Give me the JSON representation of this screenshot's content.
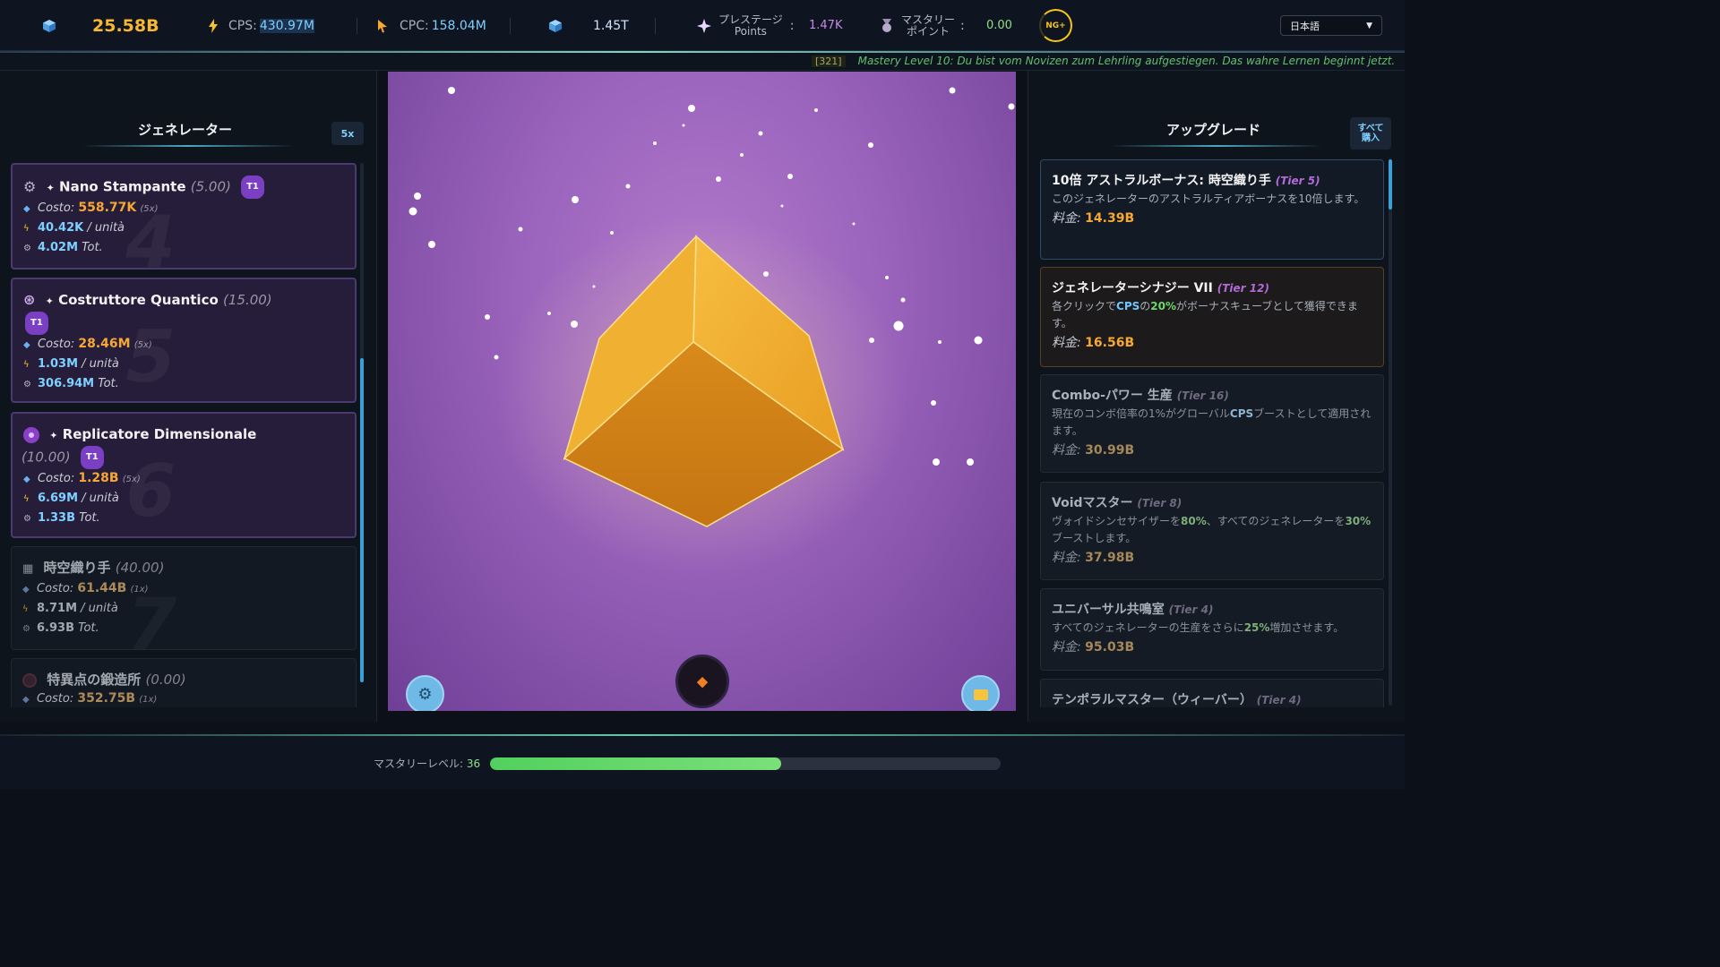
{
  "topbar": {
    "cubes": "25.58B",
    "cps_label": "CPS:",
    "cps_value": "430.97M",
    "cpc_label": "CPC:",
    "cpc_value": "158.04M",
    "total": "1.45T",
    "prestige_label_1": "プレステージ",
    "prestige_label_2": "Points",
    "prestige_colon": ":",
    "prestige_value": "1.47K",
    "mastery_label_1": "マスタリー",
    "mastery_label_2": "ポイント",
    "mastery_colon": ":",
    "mastery_value": "0.00",
    "ng_badge": "NG+",
    "language": "日本語"
  },
  "ticker": {
    "code": "[321]",
    "message": "Mastery Level 10: Du bist vom Novizen zum Lehrling aufgestiegen. Das wahre Lernen beginnt jetzt."
  },
  "generators": {
    "title": "ジェネレーター",
    "multiplier": "5x",
    "items": [
      {
        "name": "Nano Stampante",
        "owned": "(5.00)",
        "tier": "T1",
        "cost_label": "Costo:",
        "cost": "558.77K",
        "mult": "(5x)",
        "rate": "40.42K",
        "rate_unit": "/ unità",
        "total": "4.02M",
        "total_unit": "Tot.",
        "bg_number": "4"
      },
      {
        "name": "Costruttore Quantico",
        "owned": "(15.00)",
        "tier": "T1",
        "cost_label": "Costo:",
        "cost": "28.46M",
        "mult": "(5x)",
        "rate": "1.03M",
        "rate_unit": "/ unità",
        "total": "306.94M",
        "total_unit": "Tot.",
        "bg_number": "5"
      },
      {
        "name": "Replicatore Dimensionale",
        "owned": "(10.00)",
        "tier": "T1",
        "cost_label": "Costo:",
        "cost": "1.28B",
        "mult": "(5x)",
        "rate": "6.69M",
        "rate_unit": "/ unità",
        "total": "1.33B",
        "total_unit": "Tot.",
        "bg_number": "6"
      },
      {
        "name": "時空織り手",
        "owned": "(40.00)",
        "cost_label": "Costo:",
        "cost": "61.44B",
        "mult": "(1x)",
        "rate": "8.71M",
        "rate_unit": "/ unità",
        "total": "6.93B",
        "total_unit": "Tot.",
        "bg_number": "7"
      },
      {
        "name": "特異点の鍛造所",
        "owned": "(0.00)",
        "cost_label": "Costo:",
        "cost": "352.75B",
        "mult": "(1x)"
      }
    ]
  },
  "upgrades": {
    "title": "アップグレード",
    "buy_all_1": "すべて",
    "buy_all_2": "購入",
    "cost_label": "料金:",
    "items": [
      {
        "title": "10倍 アストラルボーナス: 時空織り手",
        "tier": "(Tier 5)",
        "desc": "このジェネレーターのアストラルティアボーナスを10倍します。",
        "cost": "14.39B"
      },
      {
        "title": "ジェネレーターシナジー VII",
        "tier": "(Tier 12)",
        "desc_a": "各クリックで",
        "desc_b": "CPS",
        "desc_c": "の",
        "desc_d": "20%",
        "desc_e": "がボーナスキューブとして獲得できます。",
        "cost": "16.56B"
      },
      {
        "title": "Combo-パワー 生産",
        "tier": "(Tier 16)",
        "desc_a": "現在のコンボ倍率の1%がグローバル",
        "desc_b": "CPS",
        "desc_c": "ブーストとして適用されます。",
        "cost": "30.99B"
      },
      {
        "title": "Voidマスター",
        "tier": "(Tier 8)",
        "desc_a": "ヴォイドシンセサイザーを",
        "desc_b": "80%",
        "desc_c": "、すべてのジェネレーターを",
        "desc_d": "30%",
        "desc_e": "ブーストします。",
        "cost": "37.98B"
      },
      {
        "title": "ユニバーサル共鳴室",
        "tier": "(Tier 4)",
        "desc_a": "すべてのジェネレーターの生産をさらに",
        "desc_b": "25%",
        "desc_c": "増加させます。",
        "cost": "95.03B"
      },
      {
        "title": "テンポラルマスター（ウィーバー）",
        "tier": "(Tier 4)"
      }
    ]
  },
  "bottom": {
    "mastery_label": "マスタリーレベル:",
    "mastery_level": "36",
    "progress": 0.57
  },
  "colors": {
    "accent_gold": "#f7b733",
    "accent_blue": "#7fd0ff",
    "accent_purple": "#b26ad8",
    "progress_green": "#5ad466"
  },
  "icons": {
    "cube": "cube-icon",
    "bolt": "lightning-icon",
    "cursor": "cursor-icon",
    "settings": "gear-icon",
    "folder": "folder-icon",
    "orb": "orb-icon"
  }
}
